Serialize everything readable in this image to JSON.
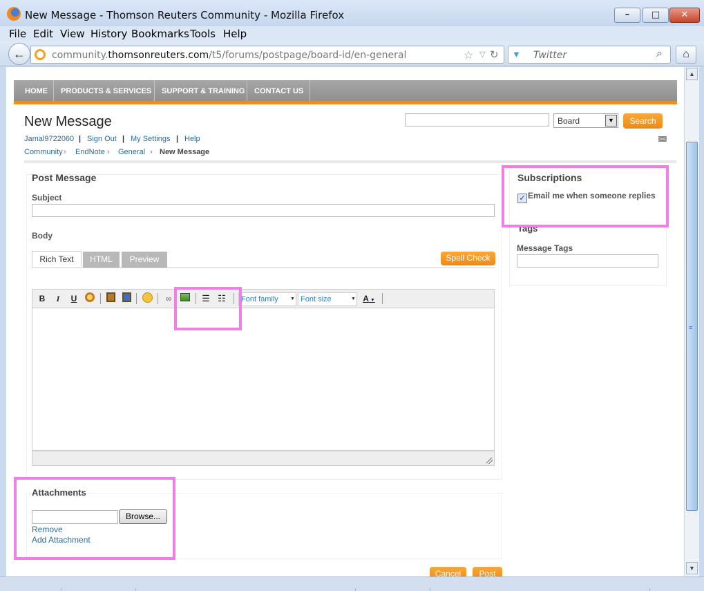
{
  "window": {
    "title": "New Message - Thomson Reuters Community - Mozilla Firefox"
  },
  "menu": [
    "File",
    "Edit",
    "View",
    "History",
    "Bookmarks",
    "Tools",
    "Help"
  ],
  "browser": {
    "url_prefix": "community.",
    "url_domain": "thomsonreuters.com",
    "url_path": "/t5/forums/postpage/board-id/en-general",
    "search_engine": "Twitter"
  },
  "site": {
    "nav": [
      "HOME",
      "PRODUCTS & SERVICES",
      "SUPPORT & TRAINING",
      "CONTACT US"
    ],
    "accent_color": "#f28c1c"
  },
  "header": {
    "title": "New Message",
    "search_scope": "Board",
    "search_button": "Search",
    "user_links": [
      "Jamal9722060",
      "Sign Out",
      "My Settings",
      "Help"
    ],
    "breadcrumb": [
      "Community",
      "EndNote",
      "General",
      "New Message"
    ]
  },
  "post": {
    "heading": "Post Message",
    "subject_label": "Subject",
    "subject_value": "",
    "body_label": "Body",
    "tabs": [
      "Rich Text",
      "HTML",
      "Preview"
    ],
    "spell_check": "Spell Check",
    "toolbar": {
      "buttons": [
        "bold",
        "italic",
        "underline",
        "insert-image",
        "paste",
        "paste-word",
        "emoticon",
        "link",
        "insert-media",
        "numbered-list",
        "bullet-list"
      ],
      "bold_glyph": "B",
      "italic_glyph": "I",
      "underline_glyph": "U",
      "font_family": "Font family",
      "font_size": "Font size",
      "font_color_glyph": "A"
    }
  },
  "sidebar": {
    "subscriptions_heading": "Subscriptions",
    "email_label": "Email me when someone replies",
    "email_checked": true,
    "tags_heading": "Tags",
    "message_tags_label": "Message Tags",
    "message_tags_value": ""
  },
  "attachments": {
    "heading": "Attachments",
    "browse": "Browse...",
    "remove": "Remove",
    "add": "Add Attachment"
  },
  "actions": {
    "cancel": "Cancel",
    "post": "Post"
  },
  "highlight_color": "#ef7fe6"
}
